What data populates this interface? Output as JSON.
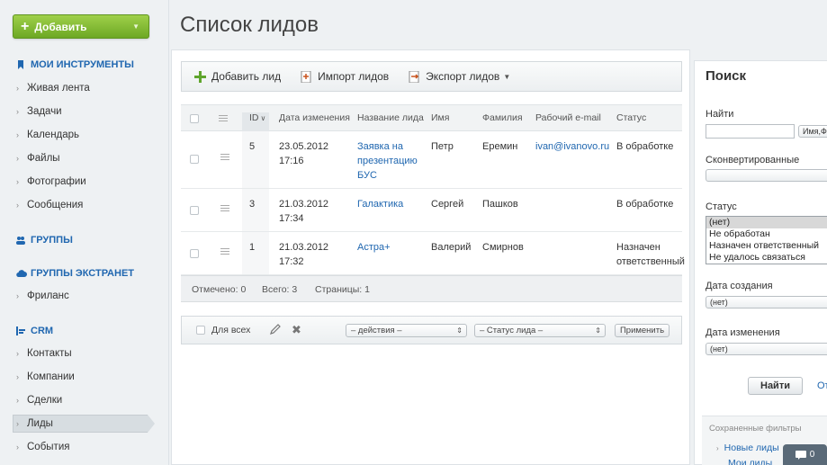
{
  "sidebar": {
    "add_button": "Добавить",
    "sections": {
      "tools": "МОИ ИНСТРУМЕНТЫ",
      "groups": "ГРУППЫ",
      "extranet": "ГРУППЫ ЭКСТРАНЕТ",
      "crm": "CRM"
    },
    "tools_items": [
      "Живая лента",
      "Задачи",
      "Календарь",
      "Файлы",
      "Фотографии",
      "Сообщения"
    ],
    "extranet_items": [
      "Фриланс"
    ],
    "crm_items": [
      "Контакты",
      "Компании",
      "Сделки",
      "Лиды",
      "События"
    ]
  },
  "page_title": "Список лидов",
  "toolbar": {
    "add_lead": "Добавить лид",
    "import": "Импорт лидов",
    "export": "Экспорт лидов"
  },
  "grid": {
    "headers": [
      "ID",
      "Дата изменения",
      "Название лида",
      "Имя",
      "Фамилия",
      "Рабочий e-mail",
      "Статус"
    ],
    "rows": [
      {
        "id": "5",
        "date": "23.05.2012",
        "time": "17:16",
        "title_lines": [
          "Заявка на",
          "презентацию",
          "БУС"
        ],
        "name": "Петр",
        "surname": "Еремин",
        "email": "ivan@ivanovo.ru",
        "status_lines": [
          "В обработке"
        ]
      },
      {
        "id": "3",
        "date": "21.03.2012",
        "time": "17:34",
        "title_lines": [
          "Галактика"
        ],
        "name": "Сергей",
        "surname": "Пашков",
        "email": "",
        "status_lines": [
          "В обработке"
        ]
      },
      {
        "id": "1",
        "date": "21.03.2012",
        "time": "17:32",
        "title_lines": [
          "Астра+"
        ],
        "name": "Валерий",
        "surname": "Смирнов",
        "email": "",
        "status_lines": [
          "Назначен",
          "ответственный"
        ]
      }
    ],
    "footer": {
      "checked": "Отмечено: 0",
      "total": "Всего: 3",
      "pages": "Страницы: 1"
    }
  },
  "actions": {
    "for_all": "Для всех",
    "actions_select": "– действия –",
    "status_select": "– Статус лида –",
    "apply": "Применить"
  },
  "search": {
    "title": "Поиск",
    "find_label": "Найти",
    "find_scope": "Имя,Фа",
    "converted_label": "Сконвертированные",
    "status_label": "Статус",
    "status_options": [
      "(нет)",
      "Не обработан",
      "Назначен ответственный",
      "Не удалось связаться"
    ],
    "created_label": "Дата создания",
    "created_value": "(нет)",
    "modified_label": "Дата изменения",
    "modified_value": "(нет)",
    "find_button": "Найти",
    "cancel_link": "От",
    "saved_filters": "Сохраненные фильтры",
    "saved_items": [
      "Новые лиды",
      "Мои лиды"
    ]
  },
  "colors": {
    "accent": "#2067b0",
    "add_button": "#7cb82f"
  }
}
